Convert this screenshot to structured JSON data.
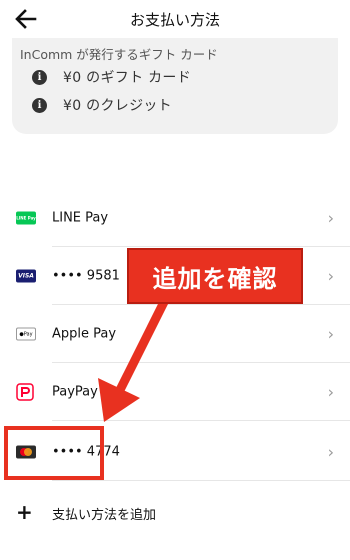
{
  "header": {
    "title": "お支払い方法",
    "back_icon": "arrow-left-icon"
  },
  "gift_card": {
    "issuer": "InComm が発行するギフト カード",
    "items": [
      {
        "icon": "info-icon",
        "text": "¥0 のギフト カード"
      },
      {
        "icon": "info-icon",
        "text": "¥0 のクレジット"
      }
    ]
  },
  "payment_methods": [
    {
      "logo": "line-pay-logo",
      "logo_text": "LINE Pay",
      "label": "LINE Pay",
      "color": "#06c755"
    },
    {
      "logo": "visa-logo",
      "logo_text": "VISA",
      "label": "•••• 9581",
      "color": "#1a1f71"
    },
    {
      "logo": "apple-pay-logo",
      "logo_text": "Pay",
      "label": "Apple Pay",
      "color": "#000000"
    },
    {
      "logo": "paypay-logo",
      "logo_text": "P",
      "label": "PayPay",
      "color": "#ff0033"
    },
    {
      "logo": "mastercard-logo",
      "logo_text": "",
      "label": "•••• 4774",
      "color": "#eb001b"
    }
  ],
  "add_method": {
    "icon": "plus-icon",
    "label": "支払い方法を追加"
  },
  "annotation": {
    "label": "追加を確認",
    "color": "#e83120"
  },
  "chevron": "›"
}
